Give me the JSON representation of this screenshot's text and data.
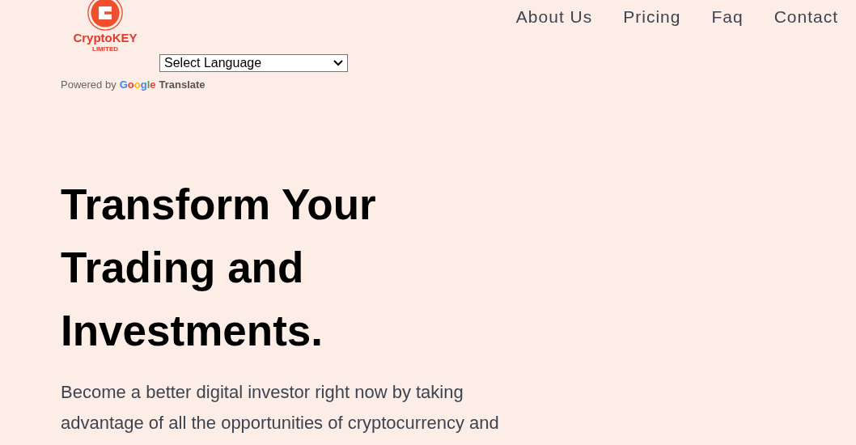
{
  "logo": {
    "name": "CryptoKEY",
    "sub": "LIMITED"
  },
  "nav": [
    {
      "label": "About Us"
    },
    {
      "label": "Pricing"
    },
    {
      "label": "Faq"
    },
    {
      "label": "Contact"
    }
  ],
  "translate": {
    "select": "Select Language",
    "powered": "Powered by",
    "google": "Google",
    "brand": "Translate"
  },
  "hero": {
    "title_lines": [
      "Transform Your",
      "Trading and",
      "Investments."
    ],
    "text_lines": [
      "Become a better digital investor right now by taking",
      "advantage of all the opportunities of cryptocurrency and"
    ]
  }
}
